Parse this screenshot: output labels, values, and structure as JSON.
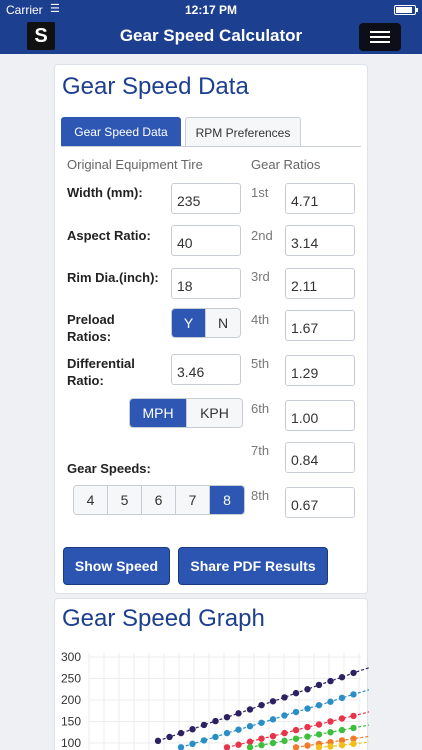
{
  "status": {
    "carrier": "Carrier",
    "time": "12:17 PM",
    "battery_level": 0.9
  },
  "nav": {
    "logo": "S",
    "title": "Gear Speed Calculator"
  },
  "data_card": {
    "title": "Gear Speed Data",
    "tabs": [
      {
        "label": "Gear Speed Data"
      },
      {
        "label": "RPM Preferences"
      }
    ],
    "tire_header": "Original Equipment Tire",
    "ratios_header": "Gear Ratios",
    "fields": {
      "width": {
        "label": "Width (mm):",
        "value": "235"
      },
      "aspect": {
        "label": "Aspect Ratio:",
        "value": "40"
      },
      "rim": {
        "label": "Rim Dia.(inch):",
        "value": "18"
      },
      "differential": {
        "label": "Differential Ratio:",
        "value": "3.46"
      }
    },
    "preload": {
      "label": "Preload Ratios:",
      "options": [
        "Y",
        "N"
      ],
      "selected": "Y"
    },
    "units": {
      "options": [
        "MPH",
        "KPH"
      ],
      "selected": "MPH"
    },
    "gear_speeds": {
      "label": "Gear Speeds:",
      "options": [
        "4",
        "5",
        "6",
        "7",
        "8"
      ],
      "selected": "8"
    },
    "ratios": [
      {
        "label": "1st",
        "value": "4.71"
      },
      {
        "label": "2nd",
        "value": "3.14"
      },
      {
        "label": "3rd",
        "value": "2.11"
      },
      {
        "label": "4th",
        "value": "1.67"
      },
      {
        "label": "5th",
        "value": "1.29"
      },
      {
        "label": "6th",
        "value": "1.00"
      },
      {
        "label": "7th",
        "value": "0.84"
      },
      {
        "label": "8th",
        "value": "0.67"
      }
    ],
    "buttons": {
      "show_speed": "Show Speed",
      "share_pdf": "Share PDF Results"
    }
  },
  "graph_card": {
    "title": "Gear Speed Graph"
  },
  "chart_data": {
    "type": "line",
    "title": "",
    "xlabel": "",
    "ylabel": "",
    "ylim": [
      100,
      300
    ],
    "y_ticks": [
      "300",
      "250",
      "200",
      "150",
      "100"
    ],
    "grid": true,
    "series": [
      {
        "color": "#2e2163",
        "values": [
          105,
          114,
          123,
          132,
          142,
          151,
          160,
          169,
          178,
          188,
          197,
          206,
          216,
          225,
          235,
          244,
          253,
          263,
          272,
          281,
          291
        ]
      },
      {
        "color": "#2b8fc7",
        "values": [
          90,
          98,
          106,
          114,
          123,
          131,
          139,
          147,
          155,
          164,
          172,
          180,
          188,
          196,
          205,
          213,
          221,
          229,
          237
        ]
      },
      {
        "color": "#e8344a",
        "values": [
          90,
          96,
          103,
          110,
          116,
          123,
          130,
          137,
          143,
          150,
          157,
          163,
          170,
          177,
          183
        ]
      },
      {
        "color": "#3dbf3d",
        "values": [
          90,
          95,
          100,
          105,
          110,
          115,
          120,
          125,
          130,
          135,
          140,
          145,
          150
        ]
      },
      {
        "color": "#f07b2a",
        "values": [
          90,
          94,
          98,
          102,
          106,
          110,
          114,
          118,
          122
        ]
      },
      {
        "color": "#f2c018",
        "values": [
          90,
          92,
          95,
          98,
          101,
          104,
          107
        ]
      }
    ]
  }
}
